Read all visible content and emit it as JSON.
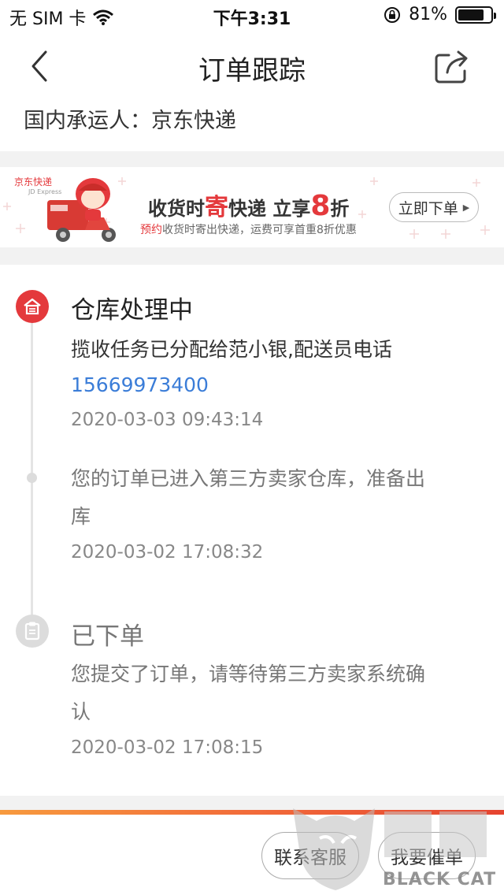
{
  "status": {
    "carrier": "无 SIM 卡",
    "time": "下午3:31",
    "battery": "81%",
    "battery_level": 0.81
  },
  "nav": {
    "title": "订单跟踪"
  },
  "carrier_line": "国内承运人：京东快递",
  "banner": {
    "logo_text": "京东快递",
    "logo_sub": "JD Express",
    "headline_pre": "收货时",
    "headline_red": "寄",
    "headline_mid": "快递 立享",
    "headline_num": "8",
    "headline_post": "折",
    "sub_red": "预约",
    "sub_text": "收货时寄出快递，运费可享首重8折优惠",
    "button": "立即下单"
  },
  "tracking": {
    "events": [
      {
        "title": "仓库处理中",
        "desc": "揽收任务已分配给范小银,配送员电话",
        "phone": "15669973400",
        "time": "2020-03-03 09:43:14"
      },
      {
        "desc_line1": "您的订单已进入第三方卖家仓库，准备出",
        "desc_line2": "库",
        "time": "2020-03-02 17:08:32"
      },
      {
        "title": "已下单",
        "desc_line1": "您提交了订单，请等待第三方卖家系统确",
        "desc_line2": "认",
        "time": "2020-03-02 17:08:15"
      }
    ]
  },
  "bottom": {
    "contact": "联系客服",
    "urge": "我要催单"
  },
  "watermark": {
    "brand": "BLACK CAT"
  },
  "colors": {
    "accent": "#e4393c",
    "link": "#3b7dd8"
  }
}
